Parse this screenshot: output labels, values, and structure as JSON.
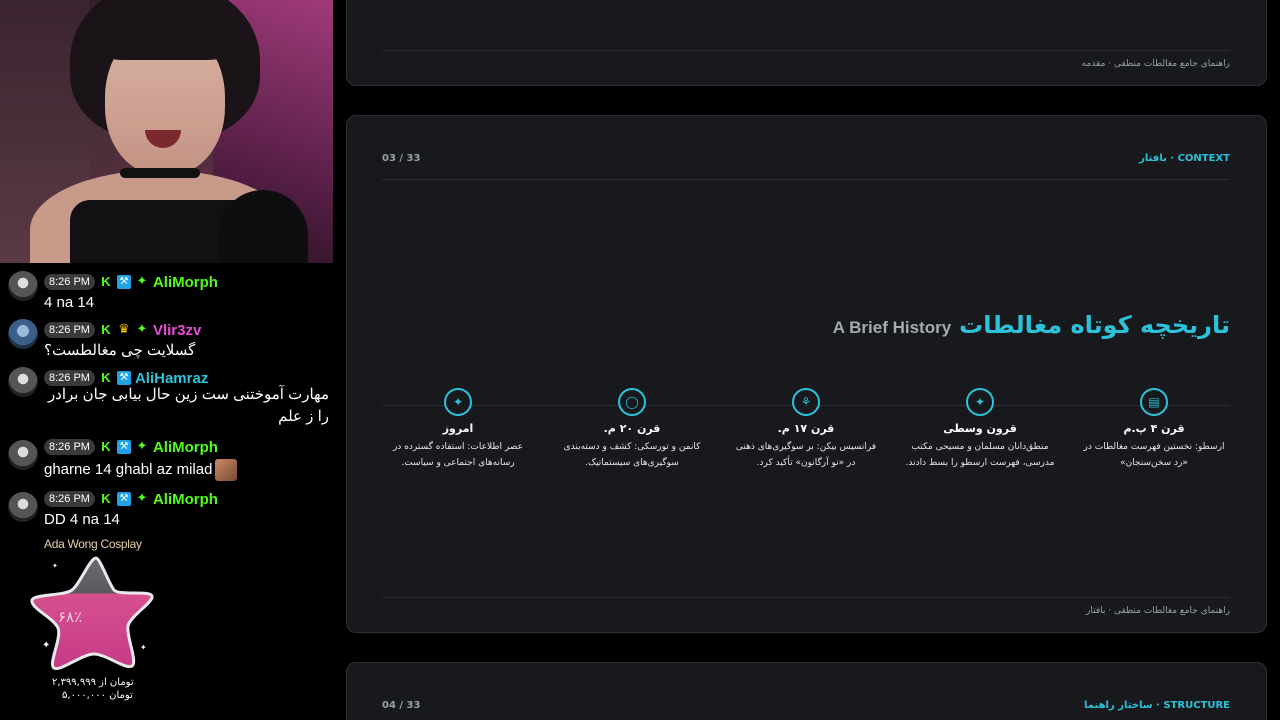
{
  "chat": {
    "messages": [
      {
        "time": "8:26 PM",
        "username": "AliMorph",
        "color": "#53fc18",
        "badges": [
          "k",
          "mod",
          "spark"
        ],
        "text": "4 na 14"
      },
      {
        "time": "8:26 PM",
        "username": "Vlir3zv",
        "color": "#e94bd6",
        "badges": [
          "k",
          "crown",
          "spark"
        ],
        "text": "گسلایت چی مغالطست؟"
      },
      {
        "time": "8:26 PM",
        "username": "AliHamraz",
        "color": "#2cc3da",
        "badges": [
          "k",
          "mod"
        ],
        "text": "مهارت آموختنی ست زین حال بیابی جان برادر را ز علم"
      },
      {
        "time": "8:26 PM",
        "username": "AliMorph",
        "color": "#53fc18",
        "badges": [
          "k",
          "mod",
          "spark"
        ],
        "text": "gharne 14 ghabl az milad"
      },
      {
        "time": "8:26 PM",
        "username": "AliMorph",
        "color": "#53fc18",
        "badges": [
          "k",
          "mod",
          "spark"
        ],
        "text": "DD 4 na 14"
      }
    ]
  },
  "goal": {
    "name": "Ada Wong Cosplay",
    "percent_label": "۶۸٪",
    "progress": 0.68,
    "line1": "۲,۳۹۹,۹۹۹ تومان از",
    "line2": "۵,۰۰۰,۰۰۰ تومان"
  },
  "slides": {
    "prev": {
      "footer": "راهنمای جامع مغالطات منطقی · مقدمه"
    },
    "current": {
      "label": "CONTEXT · بافتار",
      "number": "03 / 33",
      "title_fa": "تاریخچه کوتاه مغالطات",
      "title_en": "A Brief History",
      "timeline": [
        {
          "icon": "book-icon",
          "glyph": "▤",
          "title": "قرن ۴ پ.م",
          "desc1": "ارسطو: نخستین فهرست مغالطات در",
          "desc2": "«رد سخن‌سنجان»"
        },
        {
          "icon": "sparkle-icon",
          "glyph": "✦",
          "title": "قرون وسطی",
          "desc1": "منطق‌دانان مسلمان و مسیحی مکتب",
          "desc2": "مدرسی، فهرست ارسطو را بسط دادند."
        },
        {
          "icon": "brain-icon",
          "glyph": "⚘",
          "title": "قرن ۱۷ م.",
          "desc1": "فرانسیس بیکن: بر سوگیری‌های ذهنی",
          "desc2": "در «نو آرگانون» تأکید کرد."
        },
        {
          "icon": "circle-icon",
          "glyph": "◯",
          "title": "قرن ۲۰ م.",
          "desc1": "کانمن و تورسکی: کشف و دسته‌بندی",
          "desc2": "سوگیری‌های سیستماتیک."
        },
        {
          "icon": "sparkle-icon",
          "glyph": "✦",
          "title": "امروز",
          "desc1": "عصر اطلاعات: استفاده گسترده در",
          "desc2": "رسانه‌های اجتماعی و سیاست."
        }
      ],
      "footer": "راهنمای جامع مغالطات منطقی · بافتار"
    },
    "next": {
      "label": "STRUCTURE · ساختار راهنما",
      "number": "04 / 33"
    }
  },
  "colors": {
    "accent": "#2cc3da",
    "kick_green": "#53fc18",
    "slide_bg": "#17191c"
  }
}
